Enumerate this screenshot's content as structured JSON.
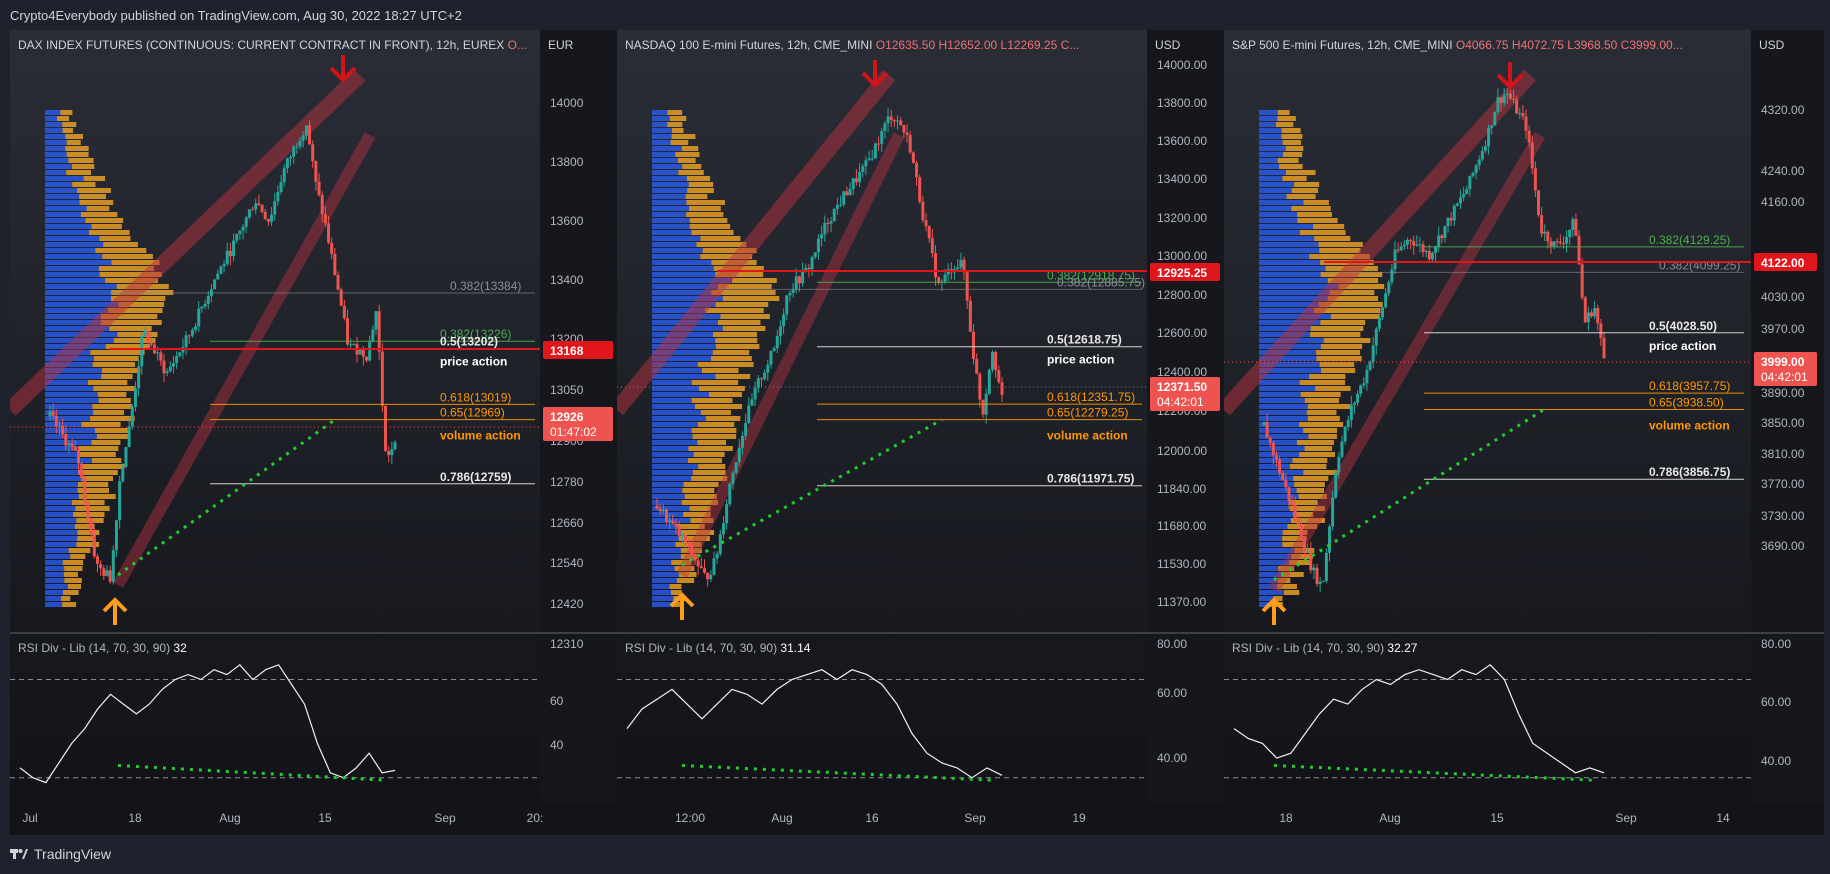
{
  "header": {
    "published": "Crypto4Everybody published on TradingView.com, Aug 30, 2022 18:27 UTC+2"
  },
  "footer": {
    "brand": "TradingView",
    "logo_icon": "tradingview-logo-icon"
  },
  "colors": {
    "up": "#26a69a",
    "down": "#ef5350",
    "fib_orange": "#ff9800",
    "fib_green": "#4caf50",
    "resistance": "#e0161c",
    "support_dots": "#1fce2a",
    "vp_blue": "#2962ff",
    "vp_orange": "#f5a623",
    "arrow_red": "#d3131a",
    "arrow_orange": "#ff9c1a"
  },
  "chart_data": [
    {
      "type": "candlestick",
      "title": "DAX INDEX FUTURES (CONTINUOUS: CURRENT CONTRACT IN FRONT), 12h, EUREX",
      "ohlc_text": "O...",
      "currency": "EUR",
      "y_ticks": [
        14000,
        13800,
        13600,
        13400,
        13200,
        13050,
        12900,
        12780,
        12660,
        12540,
        12420,
        12310
      ],
      "x_ticks": [
        "Jul",
        "18",
        "Aug",
        "15",
        "Sep",
        "20:"
      ],
      "price_badge": {
        "value": "12926",
        "timer": "01:47:02"
      },
      "resistance_badge": "13168",
      "fib_levels": [
        {
          "label": "0.382(13384)",
          "price": 13384,
          "color": "gray"
        },
        {
          "label": "0.382(13226)",
          "price": 13226,
          "color": "green"
        },
        {
          "label": "0.5(13202)",
          "price": 13202,
          "color": "white"
        },
        {
          "label": "0.618(13019)",
          "price": 13019,
          "color": "orange"
        },
        {
          "label": "0.65(12969)",
          "price": 12969,
          "color": "orange"
        },
        {
          "label": "0.786(12759)",
          "price": 12759,
          "color": "white"
        }
      ],
      "annotations": [
        "price action",
        "volume action"
      ],
      "series_path": [
        [
          0,
          12980
        ],
        [
          6,
          12840
        ],
        [
          10,
          12490
        ],
        [
          13,
          12450
        ],
        [
          15,
          12780
        ],
        [
          17,
          12940
        ],
        [
          20,
          13260
        ],
        [
          25,
          13120
        ],
        [
          30,
          13250
        ],
        [
          35,
          13420
        ],
        [
          40,
          13560
        ],
        [
          44,
          13690
        ],
        [
          47,
          13620
        ],
        [
          50,
          13780
        ],
        [
          53,
          13880
        ],
        [
          55,
          13940
        ],
        [
          57,
          13740
        ],
        [
          59,
          13610
        ],
        [
          62,
          13380
        ],
        [
          64,
          13210
        ],
        [
          66,
          13200
        ],
        [
          68,
          13180
        ],
        [
          70,
          13330
        ],
        [
          72,
          12850
        ],
        [
          74,
          12880
        ]
      ],
      "rsi": {
        "label": "RSI Div - Lib (14, 70, 30, 90)",
        "value": "32",
        "y_ticks": [
          60,
          40
        ],
        "series": [
          34,
          30,
          28,
          36,
          44,
          50,
          58,
          64,
          60,
          56,
          60,
          66,
          70,
          72,
          70,
          74,
          72,
          76,
          70,
          74,
          76,
          68,
          60,
          44,
          32,
          30,
          34,
          40,
          32,
          33
        ]
      }
    },
    {
      "type": "candlestick",
      "title": "NASDAQ 100 E-mini Futures, 12h, CME_MINI",
      "ohlc_text": "O12635.50 H12652.00 L12269.25 C...",
      "currency": "USD",
      "y_ticks": [
        14000.0,
        13800.0,
        13600.0,
        13400.0,
        13200.0,
        13000.0,
        12800.0,
        12600.0,
        12400.0,
        12200.0,
        12000.0,
        11840.0,
        11680.0,
        11530.0,
        11370.0
      ],
      "x_ticks": [
        "12:00",
        "Aug",
        "16",
        "Sep",
        "19"
      ],
      "price_badge": {
        "value": "12371.50",
        "timer": "04:42:01"
      },
      "resistance_badge": "12925.25",
      "fib_levels": [
        {
          "label": "0.382(12918.75)",
          "price": 12918.75,
          "color": "green"
        },
        {
          "label": "0.382(12885.75)",
          "price": 12885.75,
          "color": "gray"
        },
        {
          "label": "0.5(12618.75)",
          "price": 12618.75,
          "color": "white"
        },
        {
          "label": "0.618(12351.75)",
          "price": 12351.75,
          "color": "orange"
        },
        {
          "label": "0.65(12279.25)",
          "price": 12279.25,
          "color": "orange"
        },
        {
          "label": "0.786(11971.75)",
          "price": 11971.75,
          "color": "white"
        }
      ],
      "annotations": [
        "price action",
        "volume action"
      ],
      "series_path": [
        [
          0,
          11880
        ],
        [
          6,
          11700
        ],
        [
          10,
          11540
        ],
        [
          12,
          11620
        ],
        [
          15,
          11980
        ],
        [
          18,
          12260
        ],
        [
          21,
          12460
        ],
        [
          24,
          12600
        ],
        [
          27,
          12880
        ],
        [
          31,
          12980
        ],
        [
          35,
          13200
        ],
        [
          39,
          13340
        ],
        [
          43,
          13460
        ],
        [
          46,
          13600
        ],
        [
          48,
          13700
        ],
        [
          50,
          13660
        ],
        [
          52,
          13560
        ],
        [
          55,
          13200
        ],
        [
          58,
          12900
        ],
        [
          61,
          13000
        ],
        [
          63,
          13000
        ],
        [
          65,
          12600
        ],
        [
          67,
          12300
        ],
        [
          69,
          12620
        ],
        [
          71,
          12371
        ]
      ],
      "rsi": {
        "label": "RSI Div - Lib (14, 70, 30, 90)",
        "value": "31.14",
        "y_ticks": [
          60.0,
          40.0
        ],
        "series": [
          50,
          58,
          62,
          66,
          60,
          54,
          60,
          66,
          64,
          60,
          66,
          70,
          72,
          74,
          70,
          74,
          72,
          68,
          60,
          48,
          40,
          36,
          34,
          30,
          34,
          31
        ]
      }
    },
    {
      "type": "candlestick",
      "title": "S&P 500 E-mini Futures, 12h, CME_MINI",
      "ohlc_text": "O4066.75 H4072.75 L3968.50 C3999.00...",
      "currency": "USD",
      "y_ticks": [
        4320.0,
        4240.0,
        4160.0,
        4080.0,
        4030.0,
        3970.0,
        3930.0,
        3890.0,
        3850.0,
        3810.0,
        3770.0,
        3730.0,
        3690.0
      ],
      "x_ticks": [
        "18",
        "Aug",
        "15",
        "Sep",
        "14"
      ],
      "price_badge": {
        "value": "3999.00",
        "timer": "04:42:01"
      },
      "resistance_badge": "4122.00",
      "fib_levels": [
        {
          "label": "0.382(4129.25)",
          "price": 4129.25,
          "color": "green"
        },
        {
          "label": "0.382(4099.25)",
          "price": 4099.25,
          "color": "gray"
        },
        {
          "label": "0.5(4028.50)",
          "price": 4028.5,
          "color": "white"
        },
        {
          "label": "0.618(3957.75)",
          "price": 3957.75,
          "color": "orange"
        },
        {
          "label": "0.65(3938.50)",
          "price": 3938.5,
          "color": "orange"
        },
        {
          "label": "0.786(3856.75)",
          "price": 3856.75,
          "color": "white"
        }
      ],
      "annotations": [
        "price action",
        "volume action"
      ],
      "series_path": [
        [
          0,
          3920
        ],
        [
          6,
          3820
        ],
        [
          10,
          3750
        ],
        [
          12,
          3730
        ],
        [
          15,
          3880
        ],
        [
          18,
          3940
        ],
        [
          21,
          3980
        ],
        [
          24,
          4050
        ],
        [
          27,
          4120
        ],
        [
          30,
          4140
        ],
        [
          34,
          4120
        ],
        [
          38,
          4160
        ],
        [
          42,
          4200
        ],
        [
          46,
          4260
        ],
        [
          48,
          4300
        ],
        [
          50,
          4310
        ],
        [
          52,
          4290
        ],
        [
          54,
          4270
        ],
        [
          57,
          4150
        ],
        [
          60,
          4130
        ],
        [
          62,
          4140
        ],
        [
          64,
          4160
        ],
        [
          66,
          4040
        ],
        [
          68,
          4060
        ],
        [
          70,
          3999
        ]
      ],
      "rsi": {
        "label": "RSI Div - Lib (14, 70, 30, 90)",
        "value": "32.27",
        "y_ticks": [
          60.0,
          40.0
        ],
        "series": [
          50,
          46,
          44,
          38,
          40,
          48,
          56,
          62,
          60,
          66,
          70,
          68,
          72,
          74,
          72,
          70,
          74,
          72,
          76,
          70,
          56,
          44,
          40,
          36,
          32,
          34,
          32
        ]
      }
    }
  ]
}
